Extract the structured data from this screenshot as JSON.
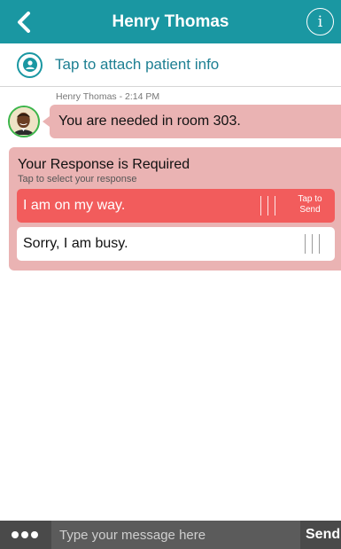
{
  "header": {
    "title": "Henry Thomas",
    "back_icon": "chevron-left-icon",
    "info_icon": "info-icon",
    "info_glyph": "i",
    "background": "#1a97a2"
  },
  "attach": {
    "label": "Tap to attach patient info",
    "icon": "person-icon"
  },
  "message": {
    "meta": "Henry Thomas - 2:14 PM",
    "text": "You are needed in room 303.",
    "bubble_color": "#eab3b3"
  },
  "response": {
    "title": "Your Response is Required",
    "subtitle": "Tap to select your response",
    "options": [
      {
        "label": "I am on my way.",
        "selected": true,
        "hint": "Tap to Send"
      },
      {
        "label": "Sorry, I am busy.",
        "selected": false
      }
    ],
    "selected_color": "#f25c5c"
  },
  "compose": {
    "placeholder": "Type your message here",
    "send_label": "Send",
    "menu_icon": "more-dots-icon"
  }
}
